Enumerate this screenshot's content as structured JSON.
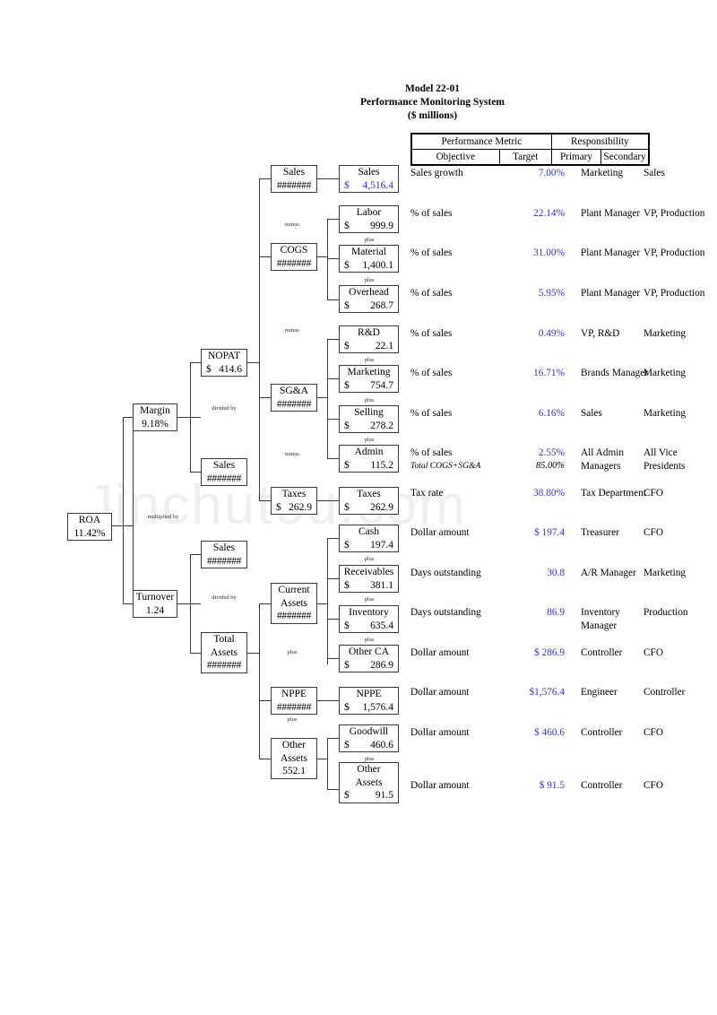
{
  "title": {
    "line1": "Model 22-01",
    "line2": "Performance Monitoring System",
    "line3": "($ millions)"
  },
  "watermark": "Jinchutou.com",
  "colors": {
    "value_blue": "#3333cc",
    "line": "#3a3a3a",
    "text": "#000000"
  },
  "header_table": {
    "group_metric": "Performance Metric",
    "group_responsibility": "Responsibility",
    "col_objective": "Objective",
    "col_target": "Target",
    "col_primary": "Primary",
    "col_secondary": "Secondary"
  },
  "operators": {
    "minus": "minus",
    "plus": "plus",
    "divided_by": "divided by",
    "multiplied_by": "multiplied by"
  },
  "tree": {
    "roa": {
      "label": "ROA",
      "value": "11.42%"
    },
    "margin": {
      "label": "Margin",
      "value": "9.18%"
    },
    "turnover": {
      "label": "Turnover",
      "value": "1.24"
    },
    "nopat": {
      "label": "NOPAT",
      "cur": "$",
      "value": "414.6"
    },
    "sales_m": {
      "label": "Sales",
      "value": "#######"
    },
    "sales_t": {
      "label": "Sales",
      "value": "#######"
    },
    "total_assets": {
      "label1": "Total",
      "label2": "Assets",
      "value": "#######"
    },
    "sales_l3": {
      "label": "Sales",
      "value": "#######"
    },
    "cogs": {
      "label": "COGS",
      "value": "#######"
    },
    "sga": {
      "label": "SG&A",
      "value": "#######"
    },
    "taxes_l3": {
      "label": "Taxes",
      "cur": "$",
      "value": "262.9"
    },
    "current_assets": {
      "label1": "Current",
      "label2": "Assets",
      "value": "#######"
    },
    "nppe_l3": {
      "label": "NPPE",
      "value": "#######"
    },
    "other_assets_l3": {
      "label1": "Other",
      "label2": "Assets",
      "value": "552.1"
    },
    "sales_l4": {
      "label": "Sales",
      "cur": "$",
      "value": "4,516.4"
    },
    "labor": {
      "label": "Labor",
      "cur": "$",
      "value": "999.9"
    },
    "material": {
      "label": "Material",
      "cur": "$",
      "value": "1,400.1"
    },
    "overhead": {
      "label": "Overhead",
      "cur": "$",
      "value": "268.7"
    },
    "rd": {
      "label": "R&D",
      "cur": "$",
      "value": "22.1"
    },
    "marketing": {
      "label": "Marketing",
      "cur": "$",
      "value": "754.7"
    },
    "selling": {
      "label": "Selling",
      "cur": "$",
      "value": "278.2"
    },
    "admin": {
      "label": "Admin",
      "cur": "$",
      "value": "115.2"
    },
    "taxes_l4": {
      "label": "Taxes",
      "cur": "$",
      "value": "262.9"
    },
    "cash": {
      "label": "Cash",
      "cur": "$",
      "value": "197.4"
    },
    "receivables": {
      "label": "Receivables",
      "cur": "$",
      "value": "381.1"
    },
    "inventory": {
      "label": "Inventory",
      "cur": "$",
      "value": "635.4"
    },
    "other_ca": {
      "label": "Other CA",
      "cur": "$",
      "value": "286.9"
    },
    "nppe_l4": {
      "label": "NPPE",
      "cur": "$",
      "value": "1,576.4"
    },
    "goodwill": {
      "label": "Goodwill",
      "cur": "$",
      "value": "460.6"
    },
    "other_assets_l4": {
      "label1": "Other",
      "label2": "Assets",
      "cur": "$",
      "value": "91.5"
    }
  },
  "metrics": [
    {
      "objective": "Sales growth",
      "target": "7.00%",
      "primary": "Marketing",
      "secondary": "Sales"
    },
    {
      "objective": "% of sales",
      "target": "22.14%",
      "primary": "Plant Manager",
      "secondary": "VP, Production"
    },
    {
      "objective": "% of sales",
      "target": "31.00%",
      "primary": "Plant Manager",
      "secondary": "VP, Production"
    },
    {
      "objective": "% of sales",
      "target": "5.95%",
      "primary": "Plant Manager",
      "secondary": "VP, Production"
    },
    {
      "objective": "% of sales",
      "target": "0.49%",
      "primary": "VP, R&D",
      "secondary": "Marketing"
    },
    {
      "objective": "% of sales",
      "target": "16.71%",
      "primary": "Brands Manager",
      "secondary": "Marketing"
    },
    {
      "objective": "% of sales",
      "target": "6.16%",
      "primary": "Sales",
      "secondary": "Marketing"
    },
    {
      "objective": "% of sales",
      "objective_sub": "Total COGS+SG&A",
      "target": "2.55%",
      "target_sub": "85.00%",
      "primary": "All Admin Managers",
      "secondary": "All Vice Presidents"
    },
    {
      "objective": "Tax rate",
      "target": "38.80%",
      "primary": "Tax Department",
      "secondary": "CFO"
    },
    {
      "objective": "Dollar amount",
      "target": "$   197.4",
      "primary": "Treasurer",
      "secondary": "CFO"
    },
    {
      "objective": "Days outstanding",
      "target": "30.8",
      "primary": "A/R Manager",
      "secondary": "Marketing"
    },
    {
      "objective": "Days outstanding",
      "target": "86.9",
      "primary": "Inventory Manager",
      "secondary": "Production"
    },
    {
      "objective": "Dollar amount",
      "target": "$   286.9",
      "primary": "Controller",
      "secondary": "CFO"
    },
    {
      "objective": "Dollar amount",
      "target": "$1,576.4",
      "primary": "Engineer",
      "secondary": "Controller"
    },
    {
      "objective": "Dollar amount",
      "target": "$   460.6",
      "primary": "Controller",
      "secondary": "CFO"
    },
    {
      "objective": "Dollar amount",
      "target": "$    91.5",
      "primary": "Controller",
      "secondary": "CFO"
    }
  ]
}
